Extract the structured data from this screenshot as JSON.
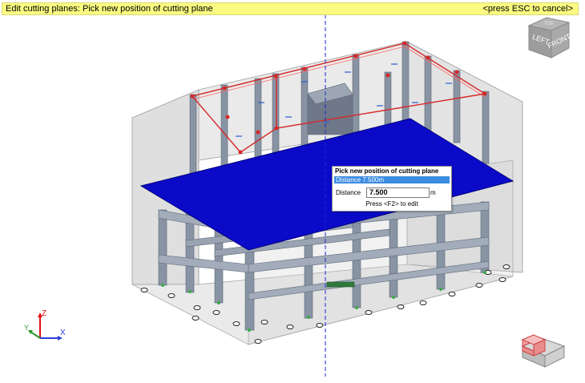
{
  "status": {
    "message": "Edit cutting planes: Pick new position of cutting plane",
    "cancel_hint": "<press ESC to cancel>"
  },
  "nav_cube": {
    "top_label": "TOP",
    "front_label": "FRONT",
    "left_label": "LEFT"
  },
  "axes": {
    "x": "X",
    "y": "Y",
    "z": "Z"
  },
  "popup": {
    "title": "Pick new position of cutting plane",
    "distance_summary": "Distance 7.500m",
    "distance_label": "Distance",
    "distance_value": "7.500",
    "unit": "m",
    "hint": "Press <F2> to edit"
  },
  "colors": {
    "cutting_plane": "#0a0ac8",
    "status_bar": "#fbfb82",
    "guide_line": "#1a2ad8",
    "column": "#8893a3"
  },
  "icons": [
    "navigation-cube-icon",
    "axis-triad-icon",
    "view-style-icon"
  ]
}
